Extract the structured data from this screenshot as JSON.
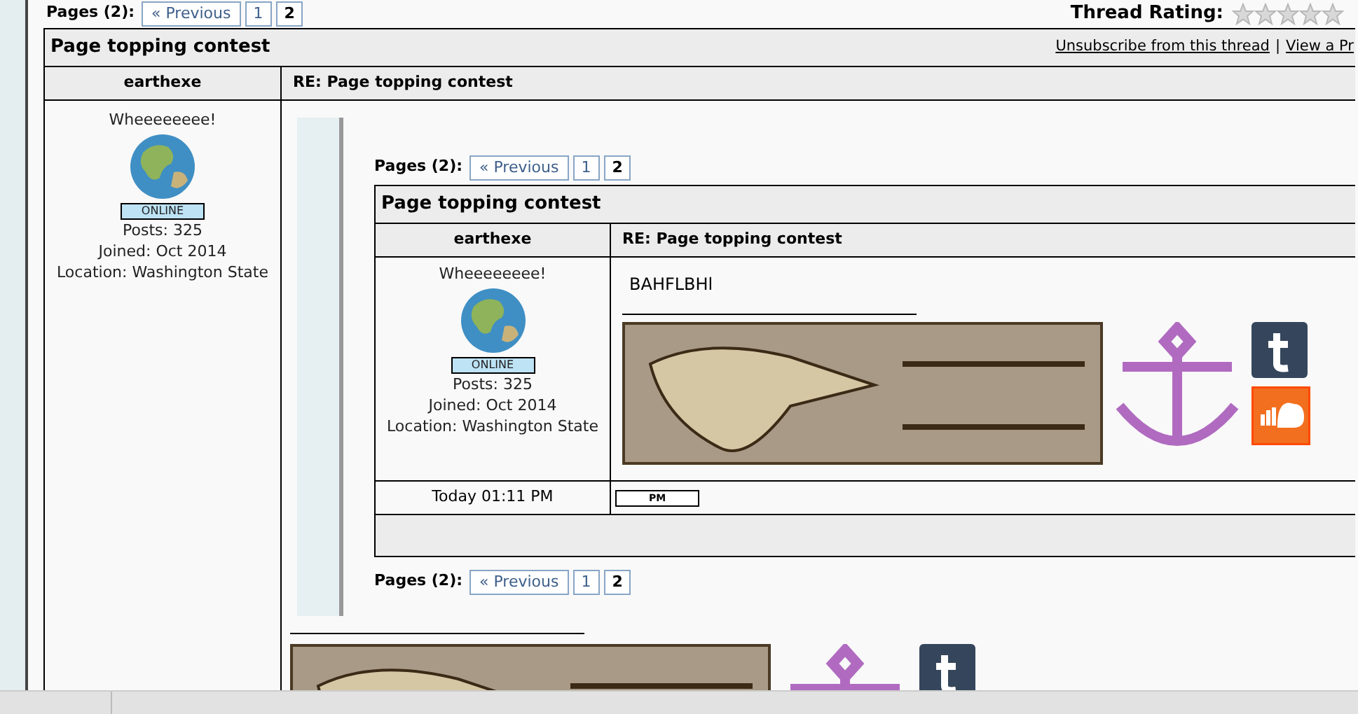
{
  "pagination_top": {
    "label": "Pages (2):",
    "previous": "« Previous",
    "pages": [
      {
        "label": "1",
        "selected": false
      },
      {
        "label": "2",
        "selected": true
      }
    ]
  },
  "thread_rating": {
    "label": "Thread Rating:",
    "stars": 0
  },
  "thread": {
    "title": "Page topping contest",
    "links": [
      "Unsubscribe from this thread",
      "View a Pr"
    ],
    "separator": "|"
  },
  "post": {
    "author": "earthexe",
    "subject": "RE: Page topping contest",
    "user_title": "Wheeeeeeee!",
    "status": "ONLINE",
    "stats": [
      "Posts: 325",
      "Joined: Oct 2014",
      "Location: Washington State"
    ]
  },
  "quote": {
    "pagination_top": {
      "label": "Pages (2):",
      "previous": "« Previous",
      "pages": [
        {
          "label": "1",
          "selected": false
        },
        {
          "label": "2",
          "selected": true
        }
      ]
    },
    "title": "Page topping contest",
    "post": {
      "author": "earthexe",
      "subject": "RE: Page topping contest",
      "user_title": "Wheeeeeeee!",
      "status": "ONLINE",
      "stats": [
        "Posts: 325",
        "Joined: Oct 2014",
        "Location: Washington State"
      ],
      "message": "BAHFLBHl",
      "date": "Today 01:11 PM",
      "buttons": [
        "PM"
      ]
    },
    "pagination_bottom": {
      "label": "Pages (2):",
      "previous": "« Previous",
      "pages": [
        {
          "label": "1",
          "selected": false
        },
        {
          "label": "2",
          "selected": true
        }
      ]
    }
  }
}
